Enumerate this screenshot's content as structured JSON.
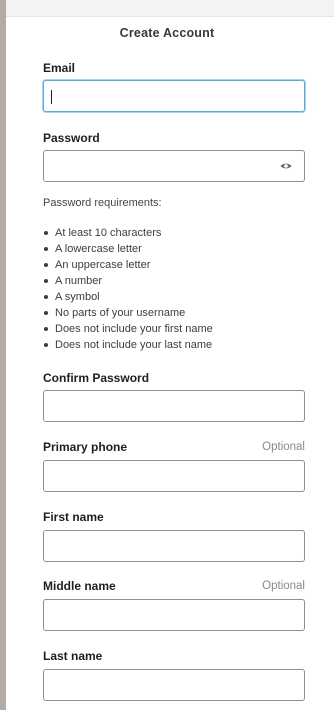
{
  "form": {
    "title": "Create Account",
    "email": {
      "label": "Email",
      "value": ""
    },
    "password": {
      "label": "Password",
      "value": "",
      "toggle_icon": "eye-icon"
    },
    "requirements": {
      "heading": "Password requirements:",
      "items": [
        "At least 10 characters",
        "A lowercase letter",
        "An uppercase letter",
        "A number",
        "A symbol",
        "No parts of your username",
        "Does not include your first name",
        "Does not include your last name"
      ]
    },
    "confirm_password": {
      "label": "Confirm Password",
      "value": ""
    },
    "primary_phone": {
      "label": "Primary phone",
      "optional": "Optional",
      "value": ""
    },
    "first_name": {
      "label": "First name",
      "value": ""
    },
    "middle_name": {
      "label": "Middle name",
      "optional": "Optional",
      "value": ""
    },
    "last_name": {
      "label": "Last name",
      "value": ""
    }
  },
  "colors": {
    "focus_border": "#5fa8d8",
    "field_border": "#8e8e93",
    "optional_text": "#8a8a8a"
  }
}
